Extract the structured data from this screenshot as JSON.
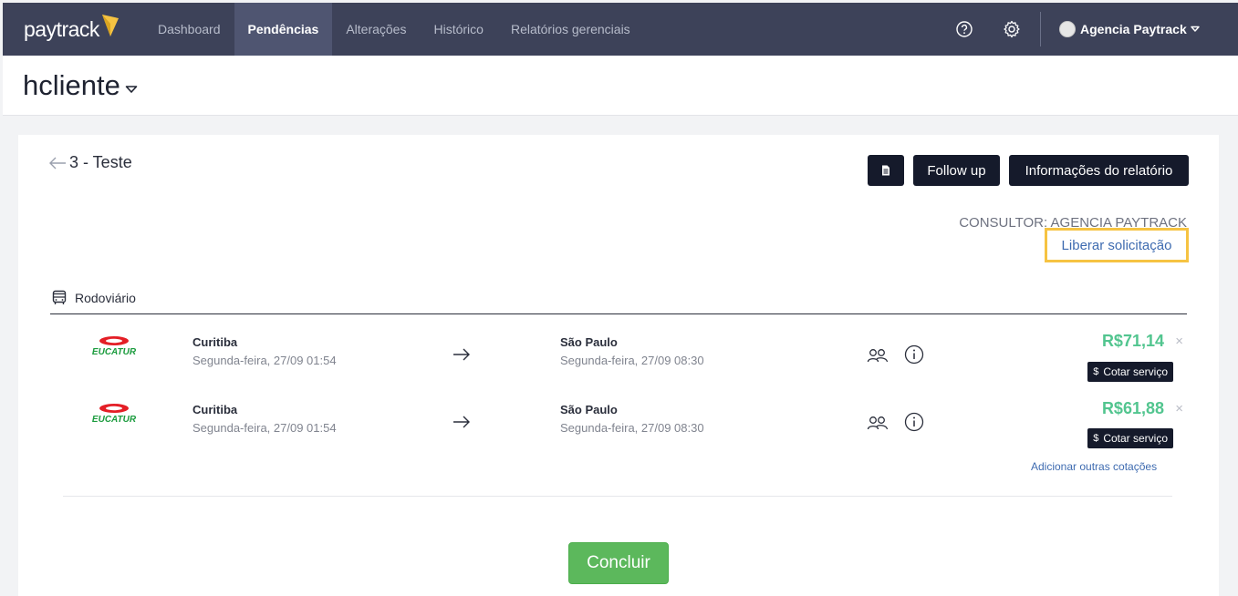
{
  "brand": {
    "name": "paytrack",
    "accent": "#f6c342"
  },
  "nav": {
    "items": [
      {
        "label": "Dashboard",
        "active": false
      },
      {
        "label": "Pendências",
        "active": true
      },
      {
        "label": "Alterações",
        "active": false
      },
      {
        "label": "Histórico",
        "active": false
      },
      {
        "label": "Relatórios gerenciais",
        "active": false
      }
    ]
  },
  "top_icons": [
    "help-icon",
    "gear-icon"
  ],
  "user": {
    "name": "Agencia Paytrack"
  },
  "client": {
    "name": "hcliente"
  },
  "report": {
    "title": "3 - Teste",
    "document_icon": "document-icon",
    "follow_up_label": "Follow up",
    "info_label": "Informações do relatório",
    "consultor": "CONSULTOR: AGENCIA PAYTRACK",
    "liberar_label": "Liberar solicitação"
  },
  "section": {
    "label": "Rodoviário",
    "icon": "bus-icon"
  },
  "trips": [
    {
      "carrier": "EUCATUR",
      "origin": "Curitiba",
      "origin_date": "Segunda-feira, 27/09 01:54",
      "destination": "São Paulo",
      "destination_date": "Segunda-feira, 27/09 08:30",
      "price": "R$71,14",
      "quote_label": "Cotar serviço",
      "remove_symbol": "×"
    },
    {
      "carrier": "EUCATUR",
      "origin": "Curitiba",
      "origin_date": "Segunda-feira, 27/09 01:54",
      "destination": "São Paulo",
      "destination_date": "Segunda-feira, 27/09 08:30",
      "price": "R$61,88",
      "quote_label": "Cotar serviço",
      "remove_symbol": "×"
    }
  ],
  "add_quotes_label": "Adicionar outras cotações",
  "conclude_label": "Concluir",
  "quote_dollar_symbol": "$",
  "colors": {
    "nav_bg": "#3d4259",
    "price": "#52c58f",
    "link": "#3e6bb0",
    "success": "#5cb85c",
    "dark_button": "#151a2b"
  }
}
